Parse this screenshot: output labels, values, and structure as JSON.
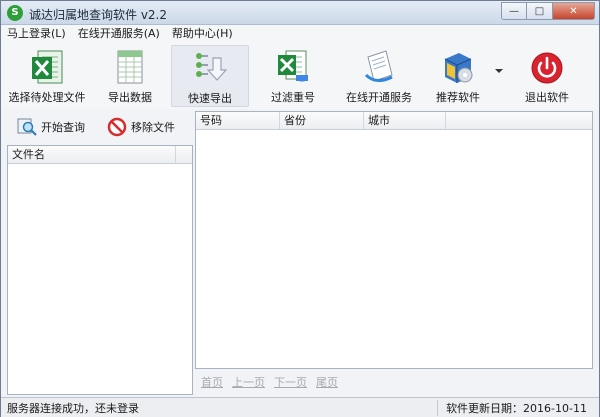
{
  "window": {
    "title": "诚达归属地查询软件 v2.2",
    "icon_glyph": "S",
    "buttons": {
      "minimize": "—",
      "maximize": "□",
      "close": "✕"
    }
  },
  "menu": [
    {
      "label": "马上登录(L)"
    },
    {
      "label": "在线开通服务(A)"
    },
    {
      "label": "帮助中心(H)"
    }
  ],
  "toolbar": {
    "items": [
      {
        "label": "选择待处理文件",
        "icon": "excel-open-icon"
      },
      {
        "label": "导出数据",
        "icon": "spreadsheet-icon"
      },
      {
        "label": "快速导出",
        "icon": "fast-export-icon"
      },
      {
        "label": "过滤重号",
        "icon": "excel-filter-icon"
      },
      {
        "label": "在线开通服务",
        "icon": "service-document-icon"
      },
      {
        "label": "推荐软件",
        "icon": "software-box-icon"
      },
      {
        "label": "退出软件",
        "icon": "power-icon"
      }
    ],
    "dropdown_icon": "chevron-down-icon"
  },
  "left_panel": {
    "start_query_label": "开始查询",
    "remove_file_label": "移除文件",
    "columns": [
      "文件名"
    ]
  },
  "table": {
    "columns": [
      "号码",
      "省份",
      "城市"
    ],
    "rows": []
  },
  "pager": {
    "first": "首页",
    "prev": "上一页",
    "next": "下一页",
    "last": "尾页"
  },
  "status": {
    "left": "服务器连接成功，还未登录",
    "right": "软件更新日期：2016-10-11"
  },
  "colors": {
    "excel_green": "#1f8a3b",
    "power_red": "#d9232e",
    "pager_disabled": "#a6aab0"
  }
}
